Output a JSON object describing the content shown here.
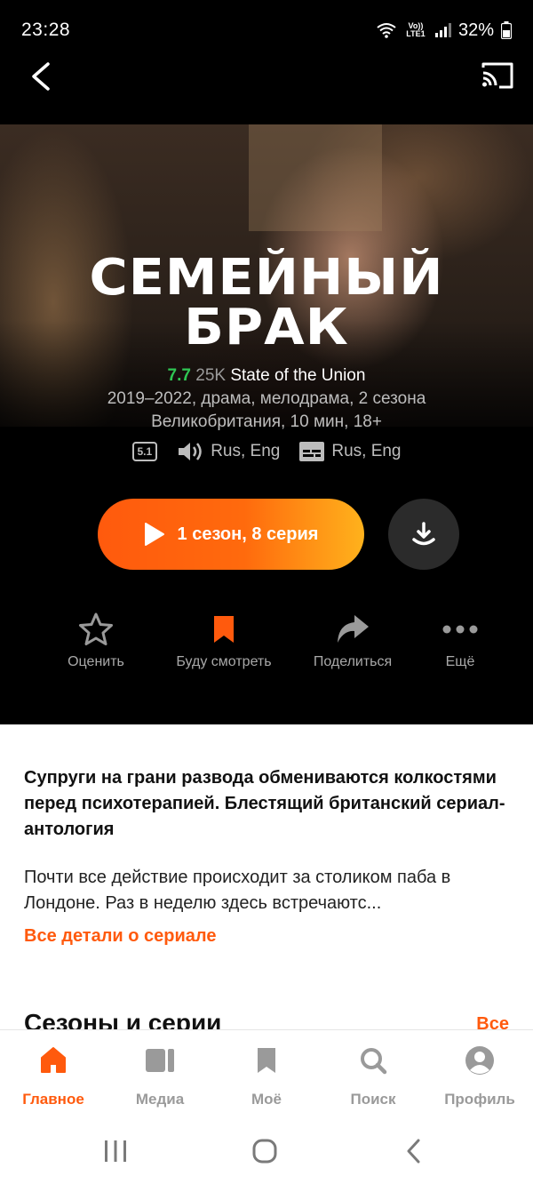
{
  "status_bar": {
    "time": "23:28",
    "network": "Vo)) LTE1",
    "battery": "32%"
  },
  "show": {
    "title_line1": "СЕМЕЙНЫЙ",
    "title_line2": "БРАК",
    "rating": "7.7",
    "votes": "25K",
    "original_title": "State of the Union",
    "meta_line1": "2019–2022, драма, мелодрама, 2 сезона",
    "meta_line2": "Великобритания, 10 мин, 18+"
  },
  "audio": {
    "surround": "5.1",
    "audio_langs": "Rus, Eng",
    "subtitle_langs": "Rus, Eng"
  },
  "play": {
    "label": "1 сезон, 8 серия"
  },
  "actions": [
    {
      "label": "Оценить",
      "icon": "star-icon"
    },
    {
      "label": "Буду смотреть",
      "icon": "bookmark-icon"
    },
    {
      "label": "Поделиться",
      "icon": "share-icon"
    },
    {
      "label": "Ещё",
      "icon": "more-icon"
    }
  ],
  "description": {
    "lead": "Супруги на грани развода обмениваются колкостями перед психотерапией. Блестящий британский сериал-антология",
    "body": "Почти все действие происходит за столиком паба в Лондоне. Раз в неделю здесь встречаютс...",
    "details_link": "Все детали о сериале"
  },
  "seasons": {
    "title": "Сезоны и серии",
    "all_link": "Все"
  },
  "bottom_nav": [
    {
      "label": "Главное",
      "icon": "home-icon",
      "active": true
    },
    {
      "label": "Медиа",
      "icon": "media-icon",
      "active": false
    },
    {
      "label": "Моё",
      "icon": "bookmark-icon",
      "active": false
    },
    {
      "label": "Поиск",
      "icon": "search-icon",
      "active": false
    },
    {
      "label": "Профиль",
      "icon": "profile-icon",
      "active": false
    }
  ],
  "colors": {
    "accent": "#ff5a0d",
    "rating": "#2fc754",
    "background": "#000000"
  }
}
